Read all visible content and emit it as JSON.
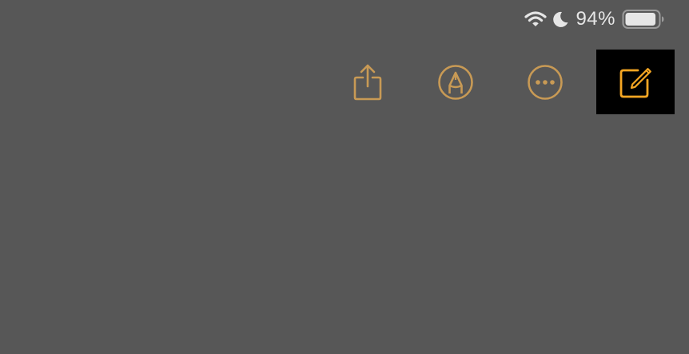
{
  "status_bar": {
    "battery_percent_text": "94%",
    "battery_level": 0.94,
    "icons": [
      "wifi-icon",
      "moon-icon",
      "battery-icon"
    ]
  },
  "toolbar": {
    "buttons": [
      {
        "icon": "share-icon"
      },
      {
        "icon": "markup-pen-icon"
      },
      {
        "icon": "more-ellipsis-icon"
      },
      {
        "icon": "compose-icon",
        "highlighted": true
      }
    ]
  },
  "colors": {
    "background": "#575757",
    "accent": "#c89a55",
    "accent_bright": "#f5a623",
    "status_text": "#e6e6e6",
    "highlight_bg": "#000000"
  }
}
